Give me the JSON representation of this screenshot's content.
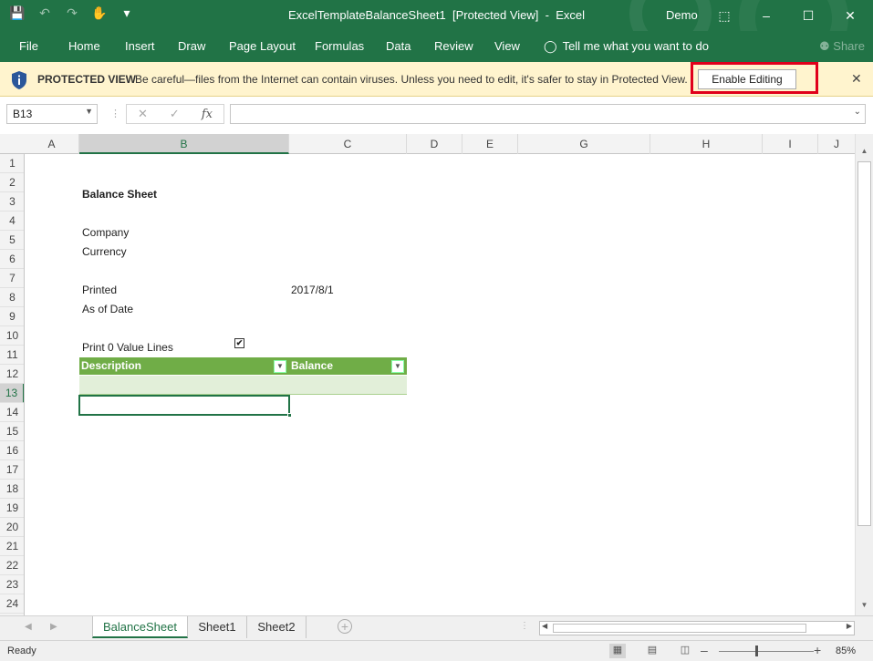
{
  "window": {
    "title": "ExcelTemplateBalanceSheet1",
    "mode": "[Protected View]",
    "app": "Excel",
    "user": "Demo"
  },
  "ribbon": {
    "tabs": [
      "File",
      "Home",
      "Insert",
      "Draw",
      "Page Layout",
      "Formulas",
      "Data",
      "Review",
      "View"
    ],
    "tell_me": "Tell me what you want to do",
    "share": "Share"
  },
  "protected": {
    "label": "PROTECTED VIEW",
    "message": "Be careful—files from the Internet can contain viruses. Unless you need to edit, it's safer to stay in Protected View.",
    "enable_button": "Enable Editing",
    "close": "✕"
  },
  "formula_bar": {
    "name_box": "B13",
    "fx": "fx",
    "formula": ""
  },
  "columns": [
    "A",
    "B",
    "C",
    "D",
    "E",
    "G",
    "H",
    "I",
    "J"
  ],
  "rows": [
    "1",
    "2",
    "3",
    "4",
    "5",
    "6",
    "7",
    "8",
    "9",
    "10",
    "11",
    "12",
    "13",
    "14",
    "15",
    "16",
    "17",
    "18",
    "19",
    "20",
    "21",
    "22",
    "23",
    "24"
  ],
  "sheet": {
    "title": "Balance Sheet",
    "company_label": "Company",
    "currency_label": "Currency",
    "printed_label": "Printed",
    "printed_value": "2017/8/1",
    "as_of_label": "As of Date",
    "print_zero_label": "Print 0 Value Lines",
    "print_zero_checked": true,
    "checkbox_mark": "✔",
    "table_headers": [
      "Description",
      "Balance"
    ]
  },
  "sheet_tabs": [
    "BalanceSheet",
    "Sheet1",
    "Sheet2"
  ],
  "active_sheet": "BalanceSheet",
  "status": {
    "ready": "Ready",
    "zoom": "85%",
    "zoom_minus": "–",
    "zoom_plus": "+"
  },
  "colors": {
    "excel_green": "#217346",
    "table_header": "#70ad47",
    "table_band": "#e2efd9",
    "protected_bg": "#fff4ce",
    "highlight": "#e0001b"
  }
}
